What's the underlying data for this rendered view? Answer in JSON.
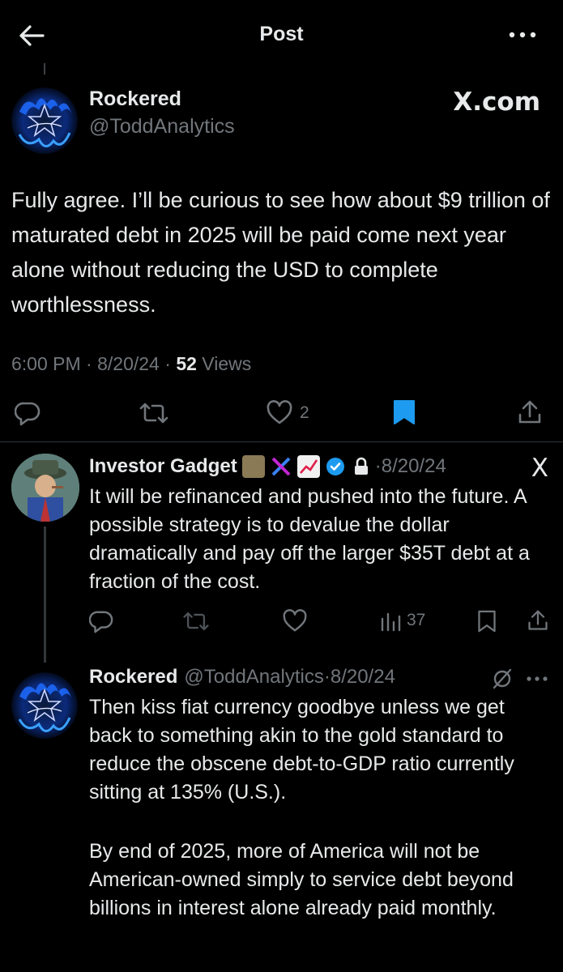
{
  "header": {
    "title": "Post",
    "back_icon": "arrow-left-icon",
    "more_icon": "more-horizontal-icon"
  },
  "main_post": {
    "author_name": "Rockered",
    "author_handle": "@ToddAnalytics",
    "platform_label": "X.com",
    "body": "Fully agree. I’ll be curious to see how about $9 trillion of maturated debt in 2025 will be paid come next year alone without reducing the USD to complete worthlessness.",
    "time": "6:00 PM",
    "date": "8/20/24",
    "views_count": "52",
    "views_label": "Views",
    "likes_count": "2",
    "bookmarked": true,
    "bookmark_color": "#1d9bf0"
  },
  "replies": [
    {
      "author_name": "Investor Gadget",
      "verified": true,
      "locked": true,
      "date": "8/20/24",
      "platform_label": "X",
      "body": "It will be refinanced and pushed into the future. A possible strategy is to devalue the dollar dramatically and pay off the larger $35T debt at a fraction of the cost.",
      "views_count": "37"
    },
    {
      "author_name": "Rockered",
      "author_handle": "@ToddAnalytics",
      "date": "8/20/24",
      "body_p1": "Then kiss fiat currency goodbye unless we get back to something akin to the gold standard to reduce the obscene debt-to-GDP ratio currently sitting at 135% (U.S.).",
      "body_p2": "By end of 2025, more of America will not be American-owned simply to service debt beyond billions in interest alone already paid monthly."
    }
  ],
  "colors": {
    "background": "#000000",
    "text": "#e7e9ea",
    "muted": "#71767b",
    "accent": "#1d9bf0",
    "divider": "#2f3336"
  }
}
